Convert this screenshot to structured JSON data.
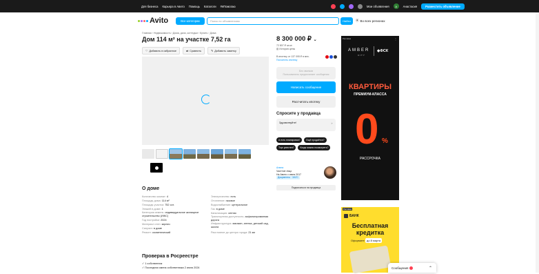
{
  "topbar": {
    "links": [
      "Для бизнеса",
      "Карьера в Авито",
      "Помощь",
      "Каталоги",
      "#яПомогаю"
    ],
    "my_listings": "Мои объявления",
    "user_initial": "А",
    "user_name": "Анастасия",
    "post_button": "Разместить объявление"
  },
  "header": {
    "logo": "Avito",
    "all_categories": "Все категории",
    "search_placeholder": "Поиск по объявлениям",
    "find_button": "Найти",
    "region": "Во всех регионах"
  },
  "breadcrumbs": "Главная › Недвижимость › Дома, дачи, коттеджи › Купить › Дома",
  "listing": {
    "title": "Дом 114 м² на участке 7,52 га",
    "actions": [
      "Добавить в избранное",
      "Сравнить",
      "Добавить заметку"
    ]
  },
  "about": {
    "heading": "О доме",
    "left": [
      {
        "k": "Количество комнат:",
        "v": "4"
      },
      {
        "k": "Площадь дома:",
        "v": "114 м²"
      },
      {
        "k": "Площадь участка:",
        "v": "752 сот."
      },
      {
        "k": "Этажей в доме:",
        "v": "1"
      },
      {
        "k": "Категория земель:",
        "v": "индивидуальное жилищное строительство (ИЖС)"
      },
      {
        "k": "Год постройки:",
        "v": "2024"
      },
      {
        "k": "Материал стен:",
        "v": "кирпич"
      },
      {
        "k": "Санузел:",
        "v": "в доме"
      },
      {
        "k": "Ремонт:",
        "v": "косметический"
      }
    ],
    "right": [
      {
        "k": "Электричество:",
        "v": "есть"
      },
      {
        "k": "Отопление:",
        "v": "газовое"
      },
      {
        "k": "Водоснабжение:",
        "v": "центральное"
      },
      {
        "k": "Газ:",
        "v": "в доме"
      },
      {
        "k": "Канализация:",
        "v": "септик"
      },
      {
        "k": "Транспортная доступность:",
        "v": "асфальтированная дорога"
      },
      {
        "k": "Инфраструктура:",
        "v": "магазин, аптека, детский сад, школа"
      },
      {
        "k": "Расстояние до центра города:",
        "v": "21 км"
      }
    ]
  },
  "rosreestr": {
    "heading": "Проверка в Росреестре",
    "items": [
      "✓ 1 собственник",
      "✓ Последняя смена собственника 2 июля 2024"
    ]
  },
  "price": {
    "value": "8 300 000 ₽",
    "per_m2": "72 807 ₽ за м²",
    "history": "История цены",
    "mortgage": "В ипотеку от 137 095 ₽ в мес.",
    "mortgage_link": "Посчитать ипотеку"
  },
  "contact": {
    "call_title": "Без звонков",
    "call_sub": "Пользователь предпочитает сообщения",
    "message_button": "Написать сообщение",
    "calc_button": "Рассчитать ипотеку"
  },
  "ask": {
    "heading": "Спросите у продавца",
    "placeholder": "Здравствуйте!",
    "send": "➤",
    "chips": [
      "А есть планировка?",
      "Ещё продаётся?",
      "Торг уместен?",
      "Когда можно посмотреть?"
    ]
  },
  "seller": {
    "name": "Алина",
    "type": "Частное лицо",
    "since": "На Авито с июня 2017",
    "docs": "Документы · ЗАГС",
    "subscribe": "Подписаться на продавца"
  },
  "ad_fsk": {
    "label": "Реклама",
    "brand": "AMBER",
    "city": "CITY",
    "fsk": "ФСК",
    "headline": "КВАРТИРЫ",
    "premium": "ПРЕМИУМ-КЛАССА",
    "zero": "0",
    "percent": "%",
    "installment": "РАССРОЧКА"
  },
  "ad_bank": {
    "label": "Реклама",
    "bank": "БАНК",
    "headline": "Бесплатная кредитка",
    "offer": "Оформите",
    "offer_date": "до 8 марта"
  },
  "chat": {
    "label": "Сообщения"
  }
}
